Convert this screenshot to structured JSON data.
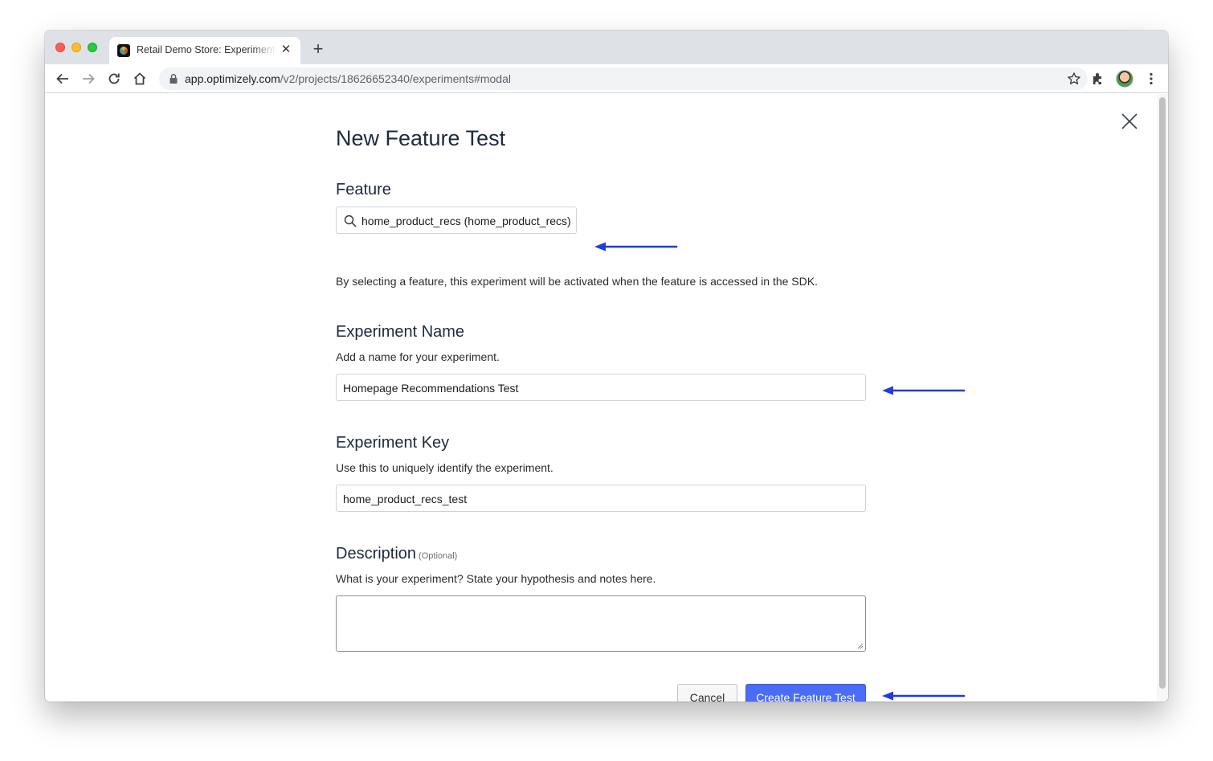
{
  "browser": {
    "tab_title": "Retail Demo Store: Experiments",
    "tab_close": "✕",
    "new_tab": "+",
    "url_host": "app.optimizely.com",
    "url_path": "/v2/projects/18626652340/experiments#modal"
  },
  "modal": {
    "title": "New Feature Test",
    "close_icon": "close-icon",
    "feature": {
      "heading": "Feature",
      "search_value": "home_product_recs (home_product_recs)",
      "help": "By selecting a feature, this experiment will be activated when the feature is accessed in the SDK."
    },
    "experiment_name": {
      "heading": "Experiment Name",
      "help": "Add a name for your experiment.",
      "value": "Homepage Recommendations Test"
    },
    "experiment_key": {
      "heading": "Experiment Key",
      "help": "Use this to uniquely identify the experiment.",
      "value": "home_product_recs_test"
    },
    "description": {
      "heading": "Description",
      "optional": "(Optional)",
      "help": "What is your experiment? State your hypothesis and notes here.",
      "value": ""
    },
    "buttons": {
      "cancel": "Cancel",
      "create": "Create Feature Test"
    }
  },
  "annotations": {
    "arrow_color": "#1f3de0"
  },
  "colors": {
    "primary_button": "#4a6cf7",
    "heading": "#1e2a3b"
  }
}
